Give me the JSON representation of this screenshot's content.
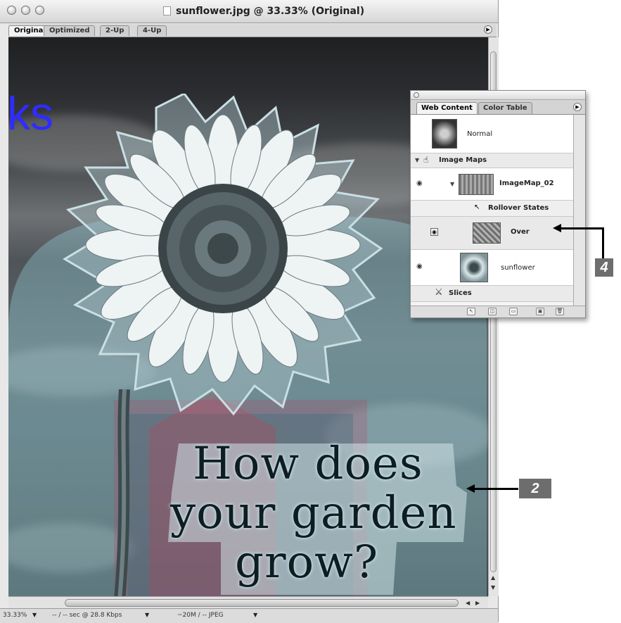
{
  "window": {
    "title": "sunflower.jpg @ 33.33% (Original)",
    "tabs": [
      "Original",
      "Optimized",
      "2-Up",
      "4-Up"
    ],
    "active_tab": "Original"
  },
  "canvas": {
    "partial_heading": "ks",
    "garden_lines": [
      "How does",
      "your garden",
      "grow?"
    ]
  },
  "status_bar": {
    "zoom": "33.33%",
    "download": "-- / -- sec @ 28.8 Kbps",
    "size": "~20M / -- JPEG"
  },
  "palette": {
    "tabs": [
      "Web Content",
      "Color Table"
    ],
    "active_tab": "Web Content",
    "rows": {
      "normal": "Normal",
      "image_maps": "Image Maps",
      "imagemap": "ImageMap_02",
      "rollover_states": "Rollover States",
      "over": "Over",
      "sunflower": "sunflower",
      "slices": "Slices"
    }
  },
  "callouts": [
    "4",
    "2"
  ],
  "colors": {
    "callout_bg": "#6d6d6d",
    "partial_heading": "#2f2cff",
    "slice_overlay": "#9fe3f0"
  }
}
